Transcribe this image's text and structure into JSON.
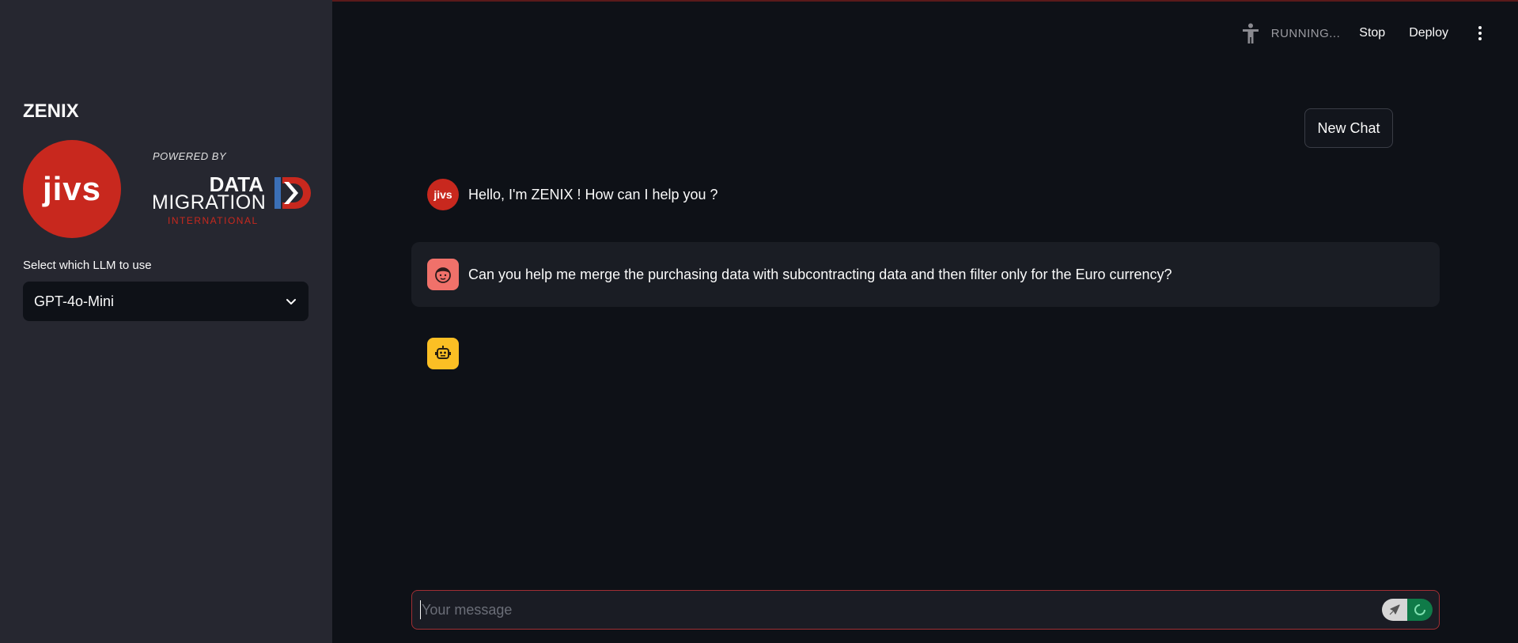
{
  "sidebar": {
    "app_title": "ZENIX",
    "jivs_logo_text": "jivs",
    "dmi_logo": {
      "powered_by": "POWERED BY",
      "line1": "DATA",
      "line2": "MIGRATION",
      "line3": "INTERNATIONAL"
    },
    "llm_label": "Select which LLM to use",
    "llm_selected": "GPT-4o-Mini"
  },
  "header": {
    "status": "RUNNING...",
    "stop_label": "Stop",
    "deploy_label": "Deploy"
  },
  "main": {
    "new_chat_label": "New Chat",
    "messages": [
      {
        "role": "assistant",
        "avatar_text": "jivs",
        "text": "Hello, I'm ZENIX ! How can I help you ?"
      },
      {
        "role": "user",
        "text": "Can you help me merge the purchasing data with subcontracting data and then filter only for the Euro currency?"
      },
      {
        "role": "assistant-pending",
        "text": ""
      }
    ],
    "input": {
      "placeholder": "Your message",
      "value": ""
    }
  },
  "colors": {
    "accent_red": "#c8281e",
    "sidebar_bg": "#262730",
    "main_bg": "#0e1117",
    "user_avatar": "#f0716a",
    "bot_avatar": "#fbbf24",
    "running_green": "#0f7a48"
  },
  "icons": [
    "accessibility-icon",
    "chevron-down-icon",
    "kebab-menu-icon",
    "user-face-icon",
    "robot-icon",
    "send-icon",
    "spinner-icon"
  ]
}
